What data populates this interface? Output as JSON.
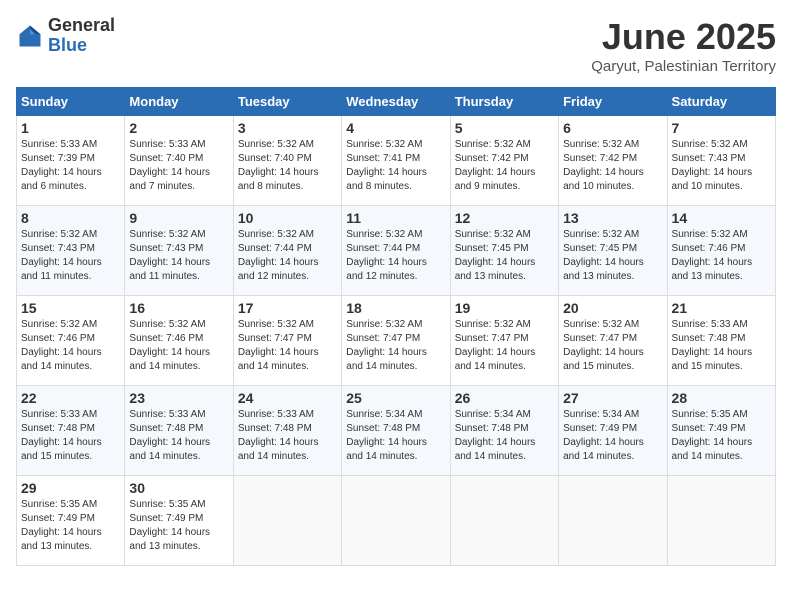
{
  "header": {
    "logo_general": "General",
    "logo_blue": "Blue",
    "month_title": "June 2025",
    "location": "Qaryut, Palestinian Territory"
  },
  "days_of_week": [
    "Sunday",
    "Monday",
    "Tuesday",
    "Wednesday",
    "Thursday",
    "Friday",
    "Saturday"
  ],
  "weeks": [
    [
      {
        "day": "1",
        "sunrise": "5:33 AM",
        "sunset": "7:39 PM",
        "daylight": "14 hours and 6 minutes."
      },
      {
        "day": "2",
        "sunrise": "5:33 AM",
        "sunset": "7:40 PM",
        "daylight": "14 hours and 7 minutes."
      },
      {
        "day": "3",
        "sunrise": "5:32 AM",
        "sunset": "7:40 PM",
        "daylight": "14 hours and 8 minutes."
      },
      {
        "day": "4",
        "sunrise": "5:32 AM",
        "sunset": "7:41 PM",
        "daylight": "14 hours and 8 minutes."
      },
      {
        "day": "5",
        "sunrise": "5:32 AM",
        "sunset": "7:42 PM",
        "daylight": "14 hours and 9 minutes."
      },
      {
        "day": "6",
        "sunrise": "5:32 AM",
        "sunset": "7:42 PM",
        "daylight": "14 hours and 10 minutes."
      },
      {
        "day": "7",
        "sunrise": "5:32 AM",
        "sunset": "7:43 PM",
        "daylight": "14 hours and 10 minutes."
      }
    ],
    [
      {
        "day": "8",
        "sunrise": "5:32 AM",
        "sunset": "7:43 PM",
        "daylight": "14 hours and 11 minutes."
      },
      {
        "day": "9",
        "sunrise": "5:32 AM",
        "sunset": "7:43 PM",
        "daylight": "14 hours and 11 minutes."
      },
      {
        "day": "10",
        "sunrise": "5:32 AM",
        "sunset": "7:44 PM",
        "daylight": "14 hours and 12 minutes."
      },
      {
        "day": "11",
        "sunrise": "5:32 AM",
        "sunset": "7:44 PM",
        "daylight": "14 hours and 12 minutes."
      },
      {
        "day": "12",
        "sunrise": "5:32 AM",
        "sunset": "7:45 PM",
        "daylight": "14 hours and 13 minutes."
      },
      {
        "day": "13",
        "sunrise": "5:32 AM",
        "sunset": "7:45 PM",
        "daylight": "14 hours and 13 minutes."
      },
      {
        "day": "14",
        "sunrise": "5:32 AM",
        "sunset": "7:46 PM",
        "daylight": "14 hours and 13 minutes."
      }
    ],
    [
      {
        "day": "15",
        "sunrise": "5:32 AM",
        "sunset": "7:46 PM",
        "daylight": "14 hours and 14 minutes."
      },
      {
        "day": "16",
        "sunrise": "5:32 AM",
        "sunset": "7:46 PM",
        "daylight": "14 hours and 14 minutes."
      },
      {
        "day": "17",
        "sunrise": "5:32 AM",
        "sunset": "7:47 PM",
        "daylight": "14 hours and 14 minutes."
      },
      {
        "day": "18",
        "sunrise": "5:32 AM",
        "sunset": "7:47 PM",
        "daylight": "14 hours and 14 minutes."
      },
      {
        "day": "19",
        "sunrise": "5:32 AM",
        "sunset": "7:47 PM",
        "daylight": "14 hours and 14 minutes."
      },
      {
        "day": "20",
        "sunrise": "5:32 AM",
        "sunset": "7:47 PM",
        "daylight": "14 hours and 15 minutes."
      },
      {
        "day": "21",
        "sunrise": "5:33 AM",
        "sunset": "7:48 PM",
        "daylight": "14 hours and 15 minutes."
      }
    ],
    [
      {
        "day": "22",
        "sunrise": "5:33 AM",
        "sunset": "7:48 PM",
        "daylight": "14 hours and 15 minutes."
      },
      {
        "day": "23",
        "sunrise": "5:33 AM",
        "sunset": "7:48 PM",
        "daylight": "14 hours and 14 minutes."
      },
      {
        "day": "24",
        "sunrise": "5:33 AM",
        "sunset": "7:48 PM",
        "daylight": "14 hours and 14 minutes."
      },
      {
        "day": "25",
        "sunrise": "5:34 AM",
        "sunset": "7:48 PM",
        "daylight": "14 hours and 14 minutes."
      },
      {
        "day": "26",
        "sunrise": "5:34 AM",
        "sunset": "7:48 PM",
        "daylight": "14 hours and 14 minutes."
      },
      {
        "day": "27",
        "sunrise": "5:34 AM",
        "sunset": "7:49 PM",
        "daylight": "14 hours and 14 minutes."
      },
      {
        "day": "28",
        "sunrise": "5:35 AM",
        "sunset": "7:49 PM",
        "daylight": "14 hours and 14 minutes."
      }
    ],
    [
      {
        "day": "29",
        "sunrise": "5:35 AM",
        "sunset": "7:49 PM",
        "daylight": "14 hours and 13 minutes."
      },
      {
        "day": "30",
        "sunrise": "5:35 AM",
        "sunset": "7:49 PM",
        "daylight": "14 hours and 13 minutes."
      },
      null,
      null,
      null,
      null,
      null
    ]
  ],
  "labels": {
    "sunrise": "Sunrise:",
    "sunset": "Sunset:",
    "daylight": "Daylight:"
  }
}
